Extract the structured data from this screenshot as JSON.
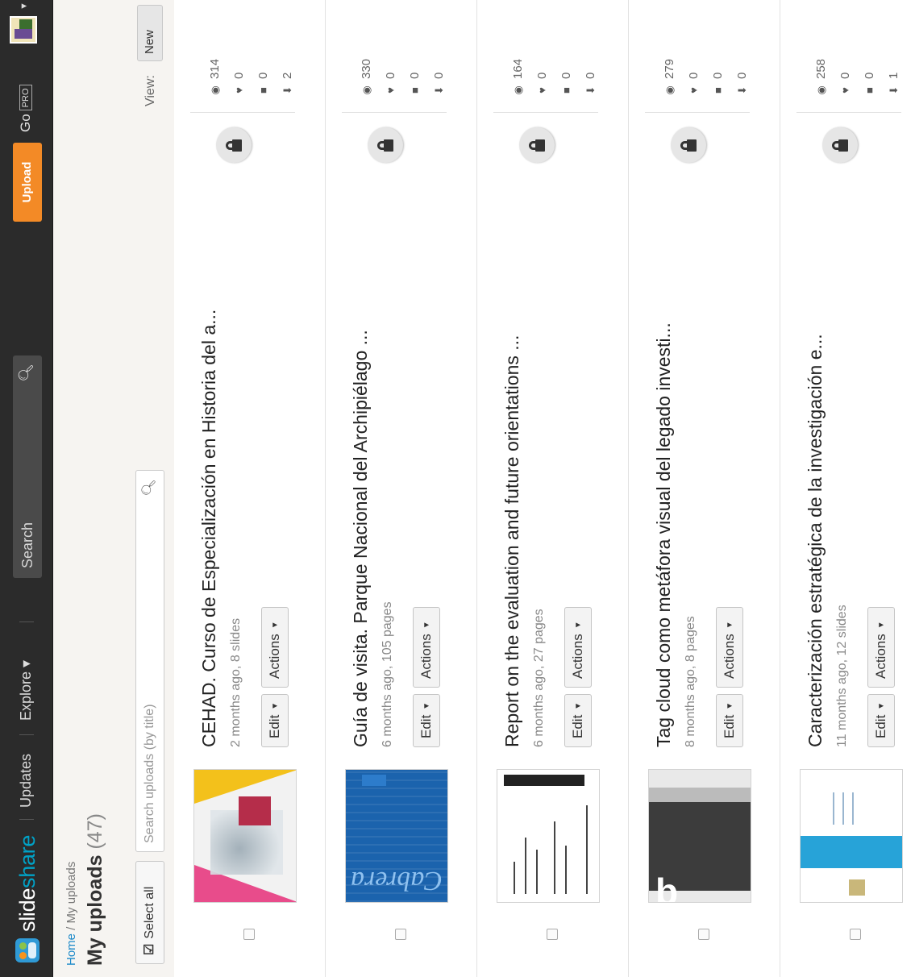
{
  "nav": {
    "brand_a": "slide",
    "brand_b": "share",
    "items": [
      "Updates",
      "Explore ▾"
    ],
    "search_placeholder": "Search",
    "upload_label": "Upload",
    "gopro_label": "Go",
    "pro_badge": "PRO"
  },
  "breadcrumb": {
    "home": "Home",
    "sep": "/",
    "current": "My uploads"
  },
  "page": {
    "title": "My uploads",
    "count": "(47)",
    "select_all": "Select all",
    "search_placeholder": "Search uploads (by title)",
    "view_label": "View:",
    "view_value": "New"
  },
  "buttons": {
    "edit": "Edit",
    "actions": "Actions"
  },
  "uploads": [
    {
      "title": "CEHAD. Curso de Especialización en Historia del a...",
      "meta": "2 months ago, 8 slides",
      "views": "314",
      "likes": "0",
      "comments": "0",
      "downloads": "2"
    },
    {
      "title": "Guía de visita. Parque Nacional del Archipiélago ...",
      "meta": "6 months ago, 105 pages",
      "views": "330",
      "likes": "0",
      "comments": "0",
      "downloads": "0"
    },
    {
      "title": "Report on the evaluation and future orientations ...",
      "meta": "6 months ago, 27 pages",
      "views": "164",
      "likes": "0",
      "comments": "0",
      "downloads": "0"
    },
    {
      "title": "Tag cloud como metáfora visual del legado investi...",
      "meta": "8 months ago, 8 pages",
      "views": "279",
      "likes": "0",
      "comments": "0",
      "downloads": "0"
    },
    {
      "title": "Caracterización estratégica de la investigación e...",
      "meta": "11 months ago, 12 slides",
      "views": "258",
      "likes": "0",
      "comments": "0",
      "downloads": "1"
    }
  ]
}
